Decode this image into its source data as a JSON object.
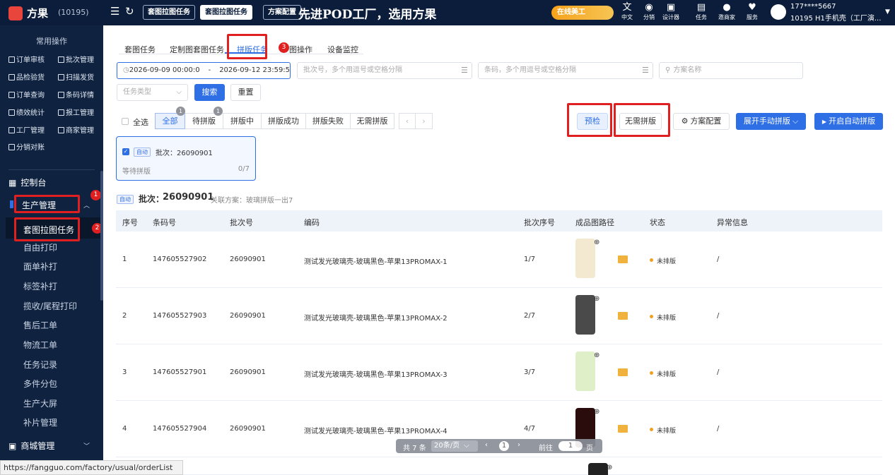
{
  "brand": {
    "name": "方果",
    "id": "(10195)"
  },
  "topbar": {
    "tabs": [
      "套图拉图任务",
      "套图拉图任务",
      "方案配置"
    ],
    "slogan": "先进POD工厂，选用方果",
    "promo": "在线美工",
    "icons": [
      {
        "icon": "translate-icon",
        "label": "中文"
      },
      {
        "icon": "distribution-icon",
        "label": "分销"
      },
      {
        "icon": "designer-icon",
        "label": "设计器"
      },
      {
        "icon": "task-icon",
        "label": "任务"
      },
      {
        "icon": "invite-icon",
        "label": "邀商家"
      },
      {
        "icon": "service-icon",
        "label": "服务"
      }
    ],
    "user_phone": "177****5667",
    "user_company": "10195 H1手机壳（工厂演..."
  },
  "sidebar": {
    "section_title": "常用操作",
    "quick_actions": [
      [
        "订单审核",
        "批次管理"
      ],
      [
        "品检验货",
        "扫描发货"
      ],
      [
        "订单查询",
        "条码详情"
      ],
      [
        "绩效统计",
        "报工管理"
      ],
      [
        "工厂管理",
        "商家管理"
      ],
      [
        "分销对账",
        ""
      ]
    ],
    "console": "控制台",
    "production": "生产管理",
    "submenu": [
      "套图拉图任务",
      "自由打印",
      "面单补打",
      "标签补打",
      "揽收/尾程打印",
      "售后工单",
      "物流工单",
      "任务记录",
      "多件分包",
      "生产大屏",
      "补片管理"
    ],
    "mall": "商城管理",
    "annotations": [
      "1",
      "2"
    ]
  },
  "tabs": {
    "items": [
      "套图任务",
      "定制图套图任务",
      "拼版任务",
      "图操作",
      "设备监控"
    ],
    "annotation": "3"
  },
  "filters": {
    "date_start": "2026-09-09 00:00:0",
    "date_sep": "-",
    "date_end": "2026-09-12 23:59:5",
    "batch_placeholder": "批次号，多个用逗号或空格分隔",
    "barcode_placeholder": "条码，多个用逗号或空格分隔",
    "plan_placeholder": "方案名称",
    "task_type_placeholder": "任务类型",
    "search": "搜索",
    "reset": "重置"
  },
  "status_bar": {
    "select_all": "全选",
    "segments": [
      {
        "label": "全部",
        "badge": "1"
      },
      {
        "label": "待拼版",
        "badge": "1"
      },
      {
        "label": "拼版中",
        "badge": ""
      },
      {
        "label": "拼版成功",
        "badge": ""
      },
      {
        "label": "拼版失败",
        "badge": ""
      },
      {
        "label": "无需拼版",
        "badge": ""
      }
    ],
    "precheck": "预检",
    "no_need": "无需拼版",
    "plan_config": "方案配置",
    "manual": "展开手动拼版",
    "auto": "开启自动拼版"
  },
  "batch_card": {
    "tag": "自动",
    "batch": "批次：26090901",
    "status": "等待拼版",
    "progress": "0/7"
  },
  "detail": {
    "tag": "自动",
    "batch_label": "批次：",
    "batch_no": "26090901",
    "plan": "关联方案：玻璃拼版一出7"
  },
  "table": {
    "headers": [
      "序号",
      "条码号",
      "批次号",
      "编码",
      "批次序号",
      "成品图路径",
      "状态",
      "异常信息"
    ],
    "rows": [
      {
        "idx": "1",
        "barcode": "147605527902",
        "batch": "26090901",
        "code": "测试发光玻璃壳-玻璃黑色-苹果13PROMAX-1",
        "seq": "1/7",
        "status": "未排版",
        "error": "/",
        "thumb_color": "#f3e9d0"
      },
      {
        "idx": "2",
        "barcode": "147605527903",
        "batch": "26090901",
        "code": "测试发光玻璃壳-玻璃黑色-苹果13PROMAX-2",
        "seq": "2/7",
        "status": "未排版",
        "error": "/",
        "thumb_color": "#4a4a4a"
      },
      {
        "idx": "3",
        "barcode": "147605527901",
        "batch": "26090901",
        "code": "测试发光玻璃壳-玻璃黑色-苹果13PROMAX-3",
        "seq": "3/7",
        "status": "未排版",
        "error": "/",
        "thumb_color": "#dff0c8"
      },
      {
        "idx": "4",
        "barcode": "147605527904",
        "batch": "26090901",
        "code": "测试发光玻璃壳-玻璃黑色-苹果13PROMAX-4",
        "seq": "4/7",
        "status": "未排版",
        "error": "/",
        "thumb_color": "#2a0c0c"
      }
    ]
  },
  "pager": {
    "total": "共 7 条",
    "size": "20条/页",
    "page": "1",
    "goto": "前往",
    "goto_val": "1",
    "page_unit": "页"
  },
  "status_url": "https://fangguo.com/factory/usual/orderList"
}
